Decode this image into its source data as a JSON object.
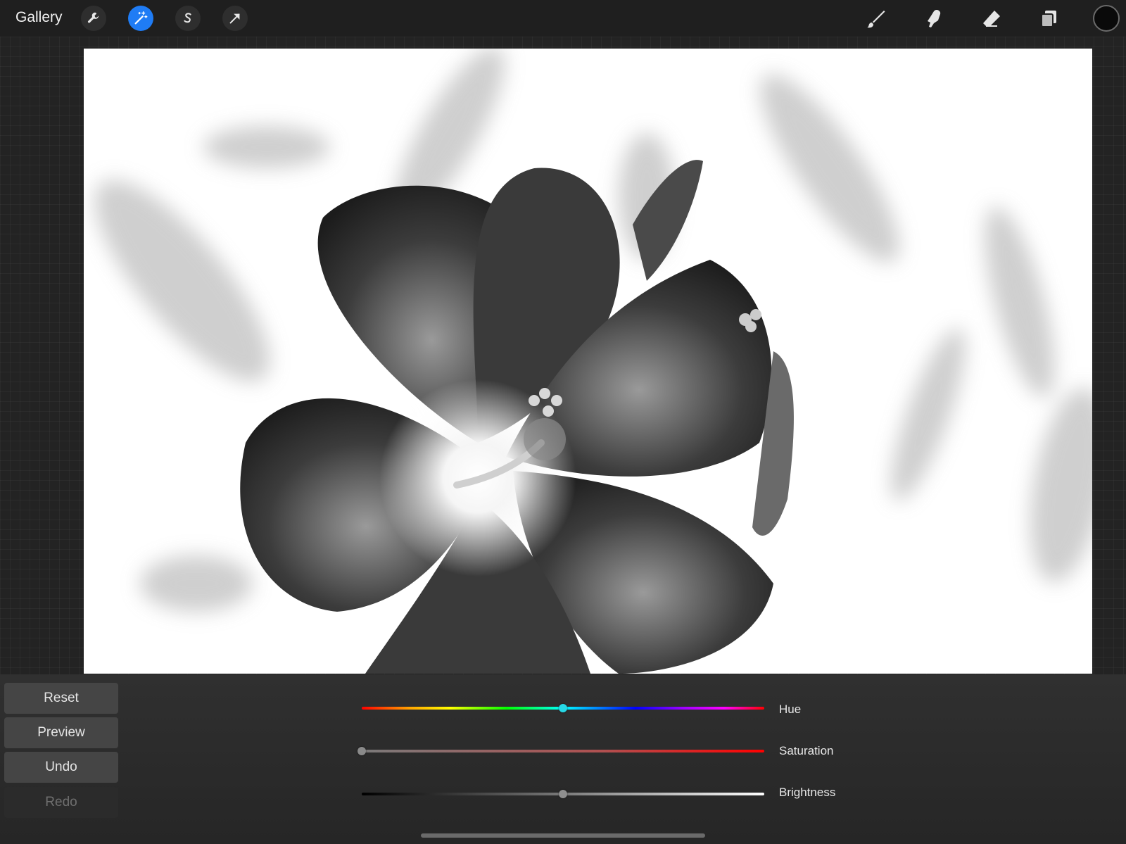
{
  "topbar": {
    "gallery_label": "Gallery",
    "left_tools": [
      "wrench-icon",
      "magic-wand-icon",
      "selection-s-icon",
      "transform-arrow-icon"
    ],
    "active_tool": "magic-wand-icon",
    "right_tools": [
      "brush-icon",
      "smudge-icon",
      "eraser-icon",
      "layers-icon"
    ],
    "current_color": "#0a0a0a",
    "accent_color": "#1f7cf5"
  },
  "canvas": {
    "content": "inverted grayscale photo of a hibiscus flower"
  },
  "side_buttons": {
    "reset": "Reset",
    "preview": "Preview",
    "undo": "Undo",
    "redo": "Redo"
  },
  "adjustments": {
    "hue": {
      "label": "Hue",
      "value": 0.5
    },
    "saturation": {
      "label": "Saturation",
      "value": 0.0
    },
    "brightness": {
      "label": "Brightness",
      "value": 0.5
    }
  }
}
